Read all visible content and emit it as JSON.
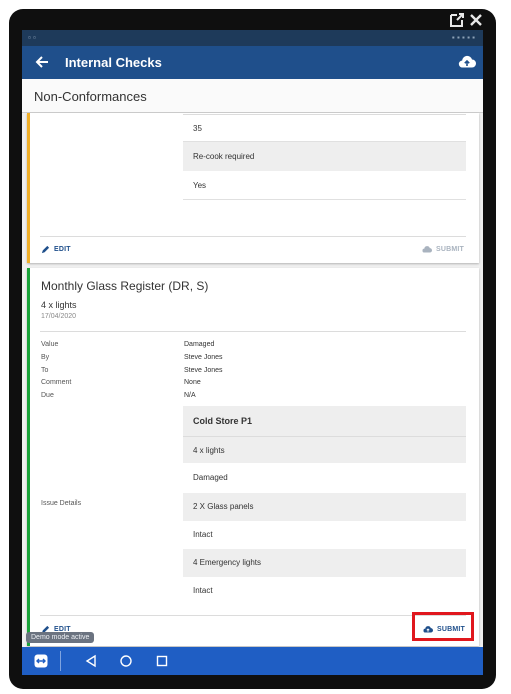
{
  "appbar": {
    "title": "Internal Checks"
  },
  "subheader": {
    "title": "Non-Conformances"
  },
  "card1": {
    "rows": [
      {
        "text": "35",
        "shaded": false
      },
      {
        "text": "Re-cook required",
        "shaded": true
      },
      {
        "text": "Yes",
        "shaded": false
      }
    ],
    "edit_label": "EDIT",
    "submit_label": "SUBMIT",
    "accent": "#f1b02a"
  },
  "card2": {
    "title": "Monthly Glass Register (DR, S)",
    "item": "4 x lights",
    "date": "17/04/2020",
    "fields": [
      {
        "label": "Value",
        "value": "Damaged"
      },
      {
        "label": "By",
        "value": "Steve Jones"
      },
      {
        "label": "To",
        "value": "Steve Jones"
      },
      {
        "label": "Comment",
        "value": "None"
      },
      {
        "label": "Due",
        "value": "N/A"
      }
    ],
    "issue_label": "Issue Details",
    "issue_rows": [
      {
        "text": "Cold Store P1",
        "shaded": true,
        "bold": true
      },
      {
        "text": "4 x lights",
        "shaded": true,
        "bold": false
      },
      {
        "text": "Damaged",
        "shaded": false,
        "bold": false
      },
      {
        "text": "2 X Glass panels",
        "shaded": true,
        "bold": false
      },
      {
        "text": "Intact",
        "shaded": false,
        "bold": false
      },
      {
        "text": "4 Emergency lights",
        "shaded": true,
        "bold": false
      },
      {
        "text": "Intact",
        "shaded": false,
        "bold": false
      }
    ],
    "edit_label": "EDIT",
    "submit_label": "SUBMIT",
    "accent": "#1aa33a"
  },
  "demo_badge": "Demo mode active",
  "colors": {
    "primary": "#1f4f8b",
    "navbar": "#1f5ec4",
    "highlight": "#e0171d"
  }
}
